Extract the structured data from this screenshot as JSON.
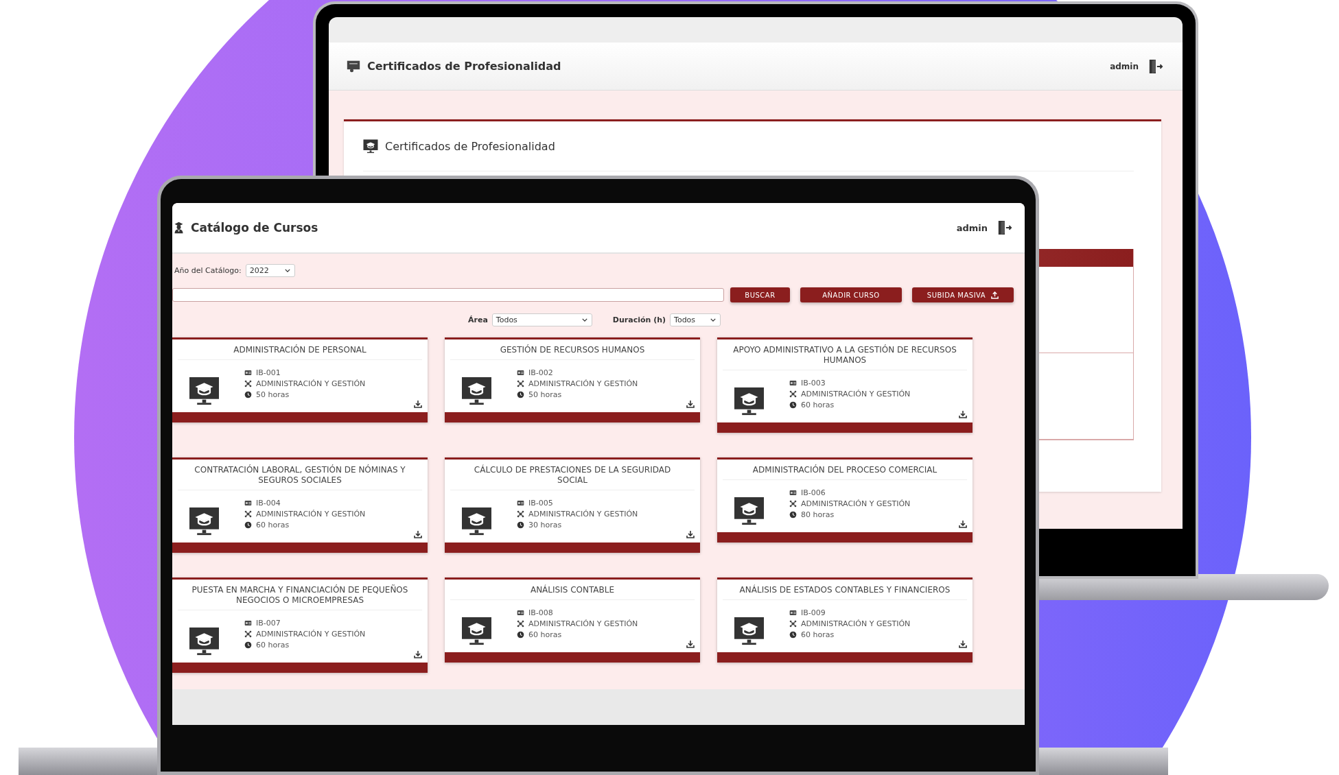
{
  "back_window": {
    "header_title": "Certificados de Profesionalidad",
    "user": "admin",
    "panel": {
      "title": "Certificados de Profesionalidad"
    }
  },
  "front_window": {
    "header_title": "Catálogo de Cursos",
    "user": "admin",
    "year_filter": {
      "label": "Año del Catálogo:",
      "value": "2022"
    },
    "buttons": [
      {
        "label": "BUSCAR",
        "kind": "plain"
      },
      {
        "label": "AÑADIR CURSO",
        "kind": "plain"
      },
      {
        "label": "SUBIDA MASIVA",
        "kind": "upload"
      }
    ],
    "filters": [
      {
        "label": "Área",
        "value": "Todos"
      },
      {
        "label": "Duración (h)",
        "value": "Todos"
      }
    ],
    "courses": [
      {
        "title": "ADMINISTRACIÓN DE PERSONAL",
        "code": "IB-001",
        "area": "ADMINISTRACIÓN Y GESTIÓN",
        "duration": "50 horas"
      },
      {
        "title": "GESTIÓN DE RECURSOS HUMANOS",
        "code": "IB-002",
        "area": "ADMINISTRACIÓN Y GESTIÓN",
        "duration": "50 horas"
      },
      {
        "title": "APOYO ADMINISTRATIVO A LA GESTIÓN DE RECURSOS HUMANOS",
        "code": "IB-003",
        "area": "ADMINISTRACIÓN Y GESTIÓN",
        "duration": "60 horas"
      },
      {
        "title": "CONTRATACIÓN LABORAL, GESTIÓN DE NÓMINAS Y SEGUROS SOCIALES",
        "code": "IB-004",
        "area": "ADMINISTRACIÓN Y GESTIÓN",
        "duration": "60 horas"
      },
      {
        "title": "CÁLCULO DE PRESTACIONES DE LA SEGURIDAD SOCIAL",
        "code": "IB-005",
        "area": "ADMINISTRACIÓN Y GESTIÓN",
        "duration": "30 horas"
      },
      {
        "title": "ADMINISTRACIÓN DEL PROCESO COMERCIAL",
        "code": "IB-006",
        "area": "ADMINISTRACIÓN Y GESTIÓN",
        "duration": "80 horas"
      },
      {
        "title": "PUESTA EN MARCHA Y FINANCIACIÓN DE PEQUEÑOS NEGOCIOS O MICROEMPRESAS",
        "code": "IB-007",
        "area": "ADMINISTRACIÓN Y GESTIÓN",
        "duration": "60 horas"
      },
      {
        "title": "ANÁLISIS CONTABLE",
        "code": "IB-008",
        "area": "ADMINISTRACIÓN Y GESTIÓN",
        "duration": "60 horas"
      },
      {
        "title": "ANÁLISIS DE ESTADOS CONTABLES Y FINANCIEROS",
        "code": "IB-009",
        "area": "ADMINISTRACIÓN Y GESTIÓN",
        "duration": "60 horas"
      }
    ]
  }
}
